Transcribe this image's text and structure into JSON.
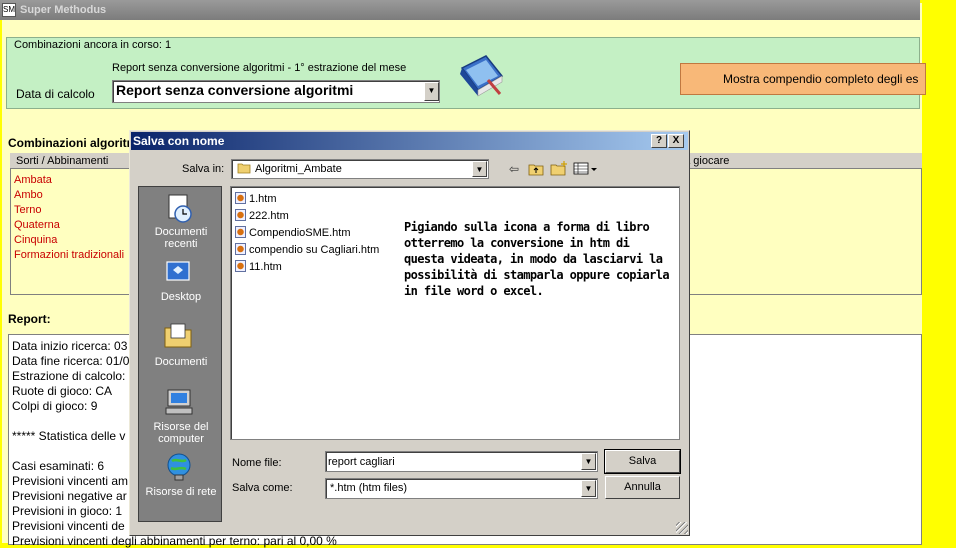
{
  "app": {
    "title": "Super Methodus",
    "calc_group_legend": "Combinazioni ancora in corso: 1",
    "calc_description": "Report senza conversione algoritmi - 1°  estrazione del mese",
    "calc_label": "Data di calcolo",
    "calc_select_value": "Report senza conversione algoritmi",
    "compendio_button": "Mostra compendio completo degli es",
    "comb_heading": "Combinazioni algoritmi",
    "comb_col1": "Sorti / Abbinamenti",
    "comb_col2": "da giocare",
    "comb_items": [
      "Ambata",
      "Ambo",
      "Terno",
      "Quaterna",
      "Cinquina",
      "Formazioni tradizionali"
    ],
    "report_label": "Report:",
    "report_lines": [
      "Data inizio ricerca: 03",
      "Data fine ricerca: 01/0",
      "Estrazione di calcolo:",
      "Ruote di gioco: CA",
      "Colpi di gioco: 9",
      "",
      "***** Statistica delle v",
      "",
      "Casi esaminati: 6",
      "Previsioni vincenti am",
      "Previsioni negative ar",
      "Previsioni in gioco: 1",
      "Previsioni vincenti de",
      "Previsioni vincenti degli abbinamenti per terno:  pari al 0,00 %"
    ]
  },
  "dialog": {
    "title": "Salva con nome",
    "help_btn": "?",
    "close_btn": "X",
    "save_in_label": "Salva in:",
    "save_in_value": "Algoritmi_Ambate",
    "places": [
      "Documenti recenti",
      "Desktop",
      "Documenti",
      "Risorse del computer",
      "Risorse di rete"
    ],
    "files": [
      "1.htm",
      "222.htm",
      "CompendioSME.htm",
      "compendio su Cagliari.htm",
      "11.htm"
    ],
    "note": "Pigiando sulla icona a forma di libro otterremo la conversione in htm di questa videata, in modo da lasciarvi la possibilità di stamparla oppure copiarla in file word o excel.",
    "filename_label": "Nome file:",
    "filename_value": "report cagliari",
    "filetype_label": "Salva come:",
    "filetype_value": "*.htm (htm files)",
    "save_button": "Salva",
    "cancel_button": "Annulla",
    "accent_color": "#0a246a"
  }
}
